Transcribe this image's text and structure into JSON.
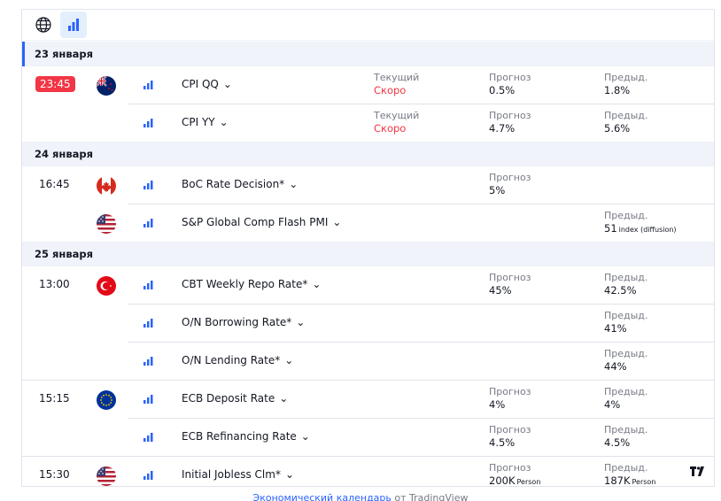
{
  "toolbar": {
    "globe_icon": "globe-icon",
    "chart_icon": "bar-chart-icon"
  },
  "labels": {
    "current": "Текущий",
    "forecast": "Прогноз",
    "previous": "Предыд.",
    "soon": "Скоро"
  },
  "dates": [
    "23 января",
    "24 января",
    "25 января"
  ],
  "events": [
    {
      "time": "23:45",
      "country": "NZ",
      "name": "CPI QQ",
      "actual": "Скоро",
      "forecast": "0.5%",
      "previous": "1.8%"
    },
    {
      "time": "",
      "country": "NZ",
      "name": "CPI YY",
      "actual": "Скоро",
      "forecast": "4.7%",
      "previous": "5.6%"
    },
    {
      "time": "16:45",
      "country": "CA",
      "name": "BoC Rate Decision*",
      "forecast": "5%"
    },
    {
      "time": "",
      "country": "US",
      "name": "S&P Global Comp Flash PMI",
      "previous": "51",
      "previous_unit": "index (diffusion)"
    },
    {
      "time": "13:00",
      "country": "TR",
      "name": "CBT Weekly Repo Rate*",
      "forecast": "45%",
      "previous": "42.5%"
    },
    {
      "time": "",
      "country": "TR",
      "name": "O/N Borrowing Rate*",
      "previous": "41%"
    },
    {
      "time": "",
      "country": "TR",
      "name": "O/N Lending Rate*",
      "previous": "44%"
    },
    {
      "time": "15:15",
      "country": "EU",
      "name": "ECB Deposit Rate",
      "forecast": "4%",
      "previous": "4%"
    },
    {
      "time": "",
      "country": "EU",
      "name": "ECB Refinancing Rate",
      "forecast": "4.5%",
      "previous": "4.5%"
    },
    {
      "time": "15:30",
      "country": "US",
      "name": "Initial Jobless Clm*",
      "forecast": "200K",
      "forecast_unit": "Person",
      "previous": "187K",
      "previous_unit": "Person"
    }
  ],
  "footer": {
    "link": "Экономический календарь",
    "rest": " от TradingView"
  },
  "colors": {
    "accent": "#2962ff",
    "red": "#f23645",
    "muted": "#787b86",
    "date_bg": "#f0f3fa"
  }
}
